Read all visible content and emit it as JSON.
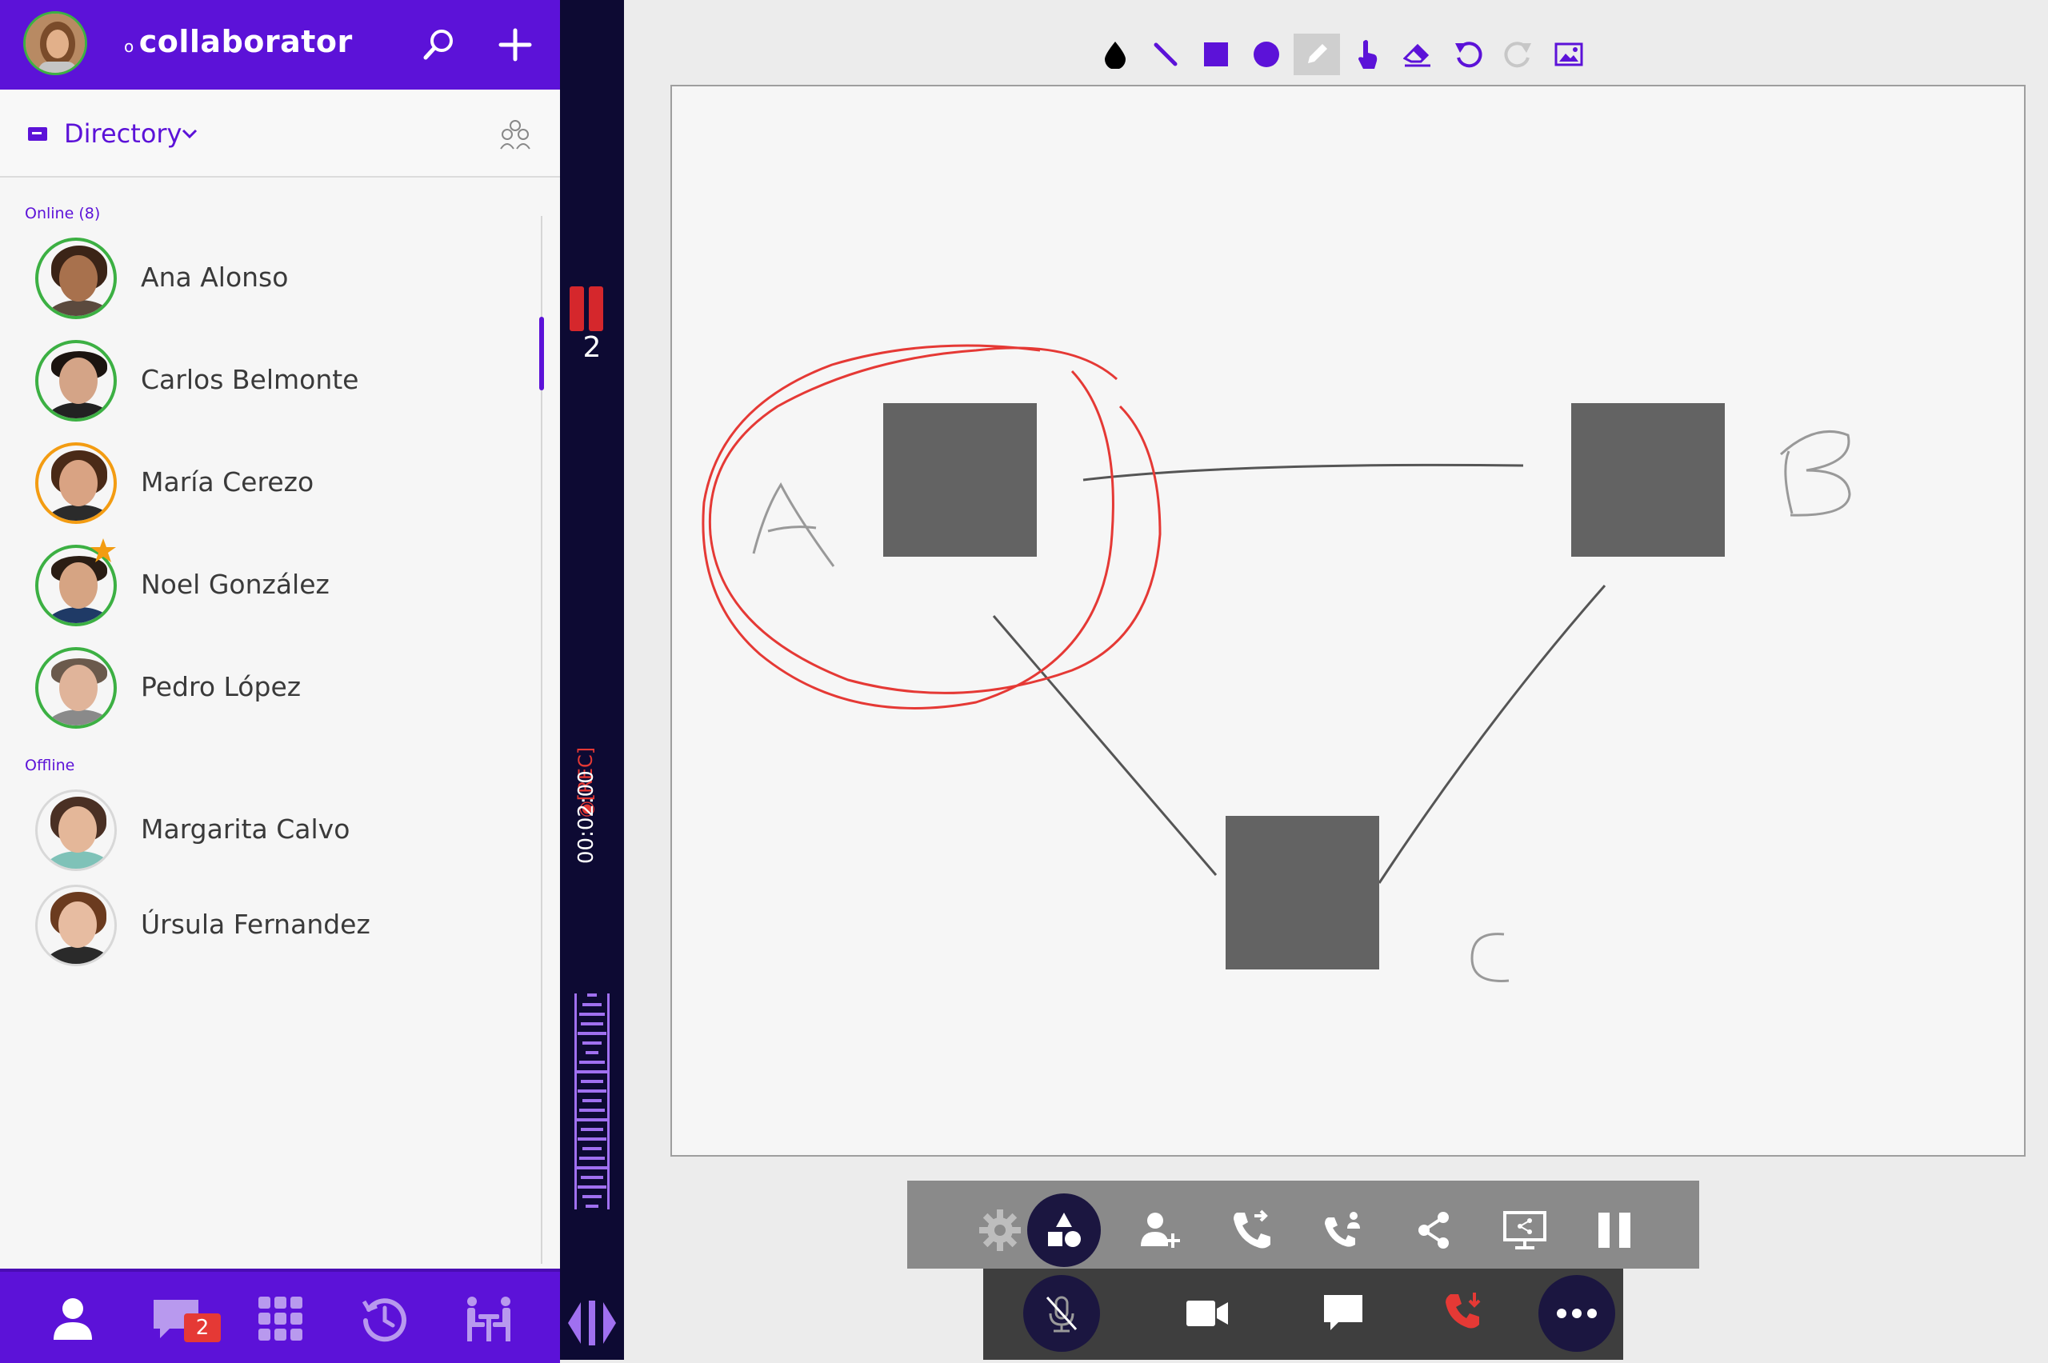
{
  "app": {
    "name": "collaborator",
    "name_prefix": "o"
  },
  "directory": {
    "label": "Directory"
  },
  "sections": {
    "online_label": "Online (8)",
    "offline_label": "Offline"
  },
  "contacts_online": [
    {
      "name": "Ana Alonso",
      "status": "online"
    },
    {
      "name": "Carlos Belmonte",
      "status": "online"
    },
    {
      "name": "María Cerezo",
      "status": "away"
    },
    {
      "name": "Noel González",
      "status": "online",
      "favorite": true
    },
    {
      "name": "Pedro López",
      "status": "online"
    }
  ],
  "contacts_offline": [
    {
      "name": "Margarita Calvo",
      "status": "offline"
    },
    {
      "name": "Úrsula Fernandez",
      "status": "offline"
    }
  ],
  "bottom_nav": {
    "chat_badge": "2"
  },
  "call": {
    "participant_count": "2",
    "timer": "00:02:00",
    "rec_label": "[REC]"
  },
  "whiteboard": {
    "tools": [
      "color-drop-icon",
      "line-icon",
      "rectangle-icon",
      "circle-icon",
      "pencil-icon",
      "touch-icon",
      "eraser-icon",
      "undo-icon",
      "redo-icon",
      "image-icon"
    ],
    "active_tool": "pencil-icon",
    "labels": {
      "a": "A",
      "b": "B",
      "c": "C"
    }
  },
  "colors": {
    "brand": "#5c12d8",
    "rec": "#e53935",
    "online": "#3cb043",
    "away": "#f39c12",
    "strip": "#0d0a33",
    "box": "#636363",
    "annotation": "#e53935"
  }
}
